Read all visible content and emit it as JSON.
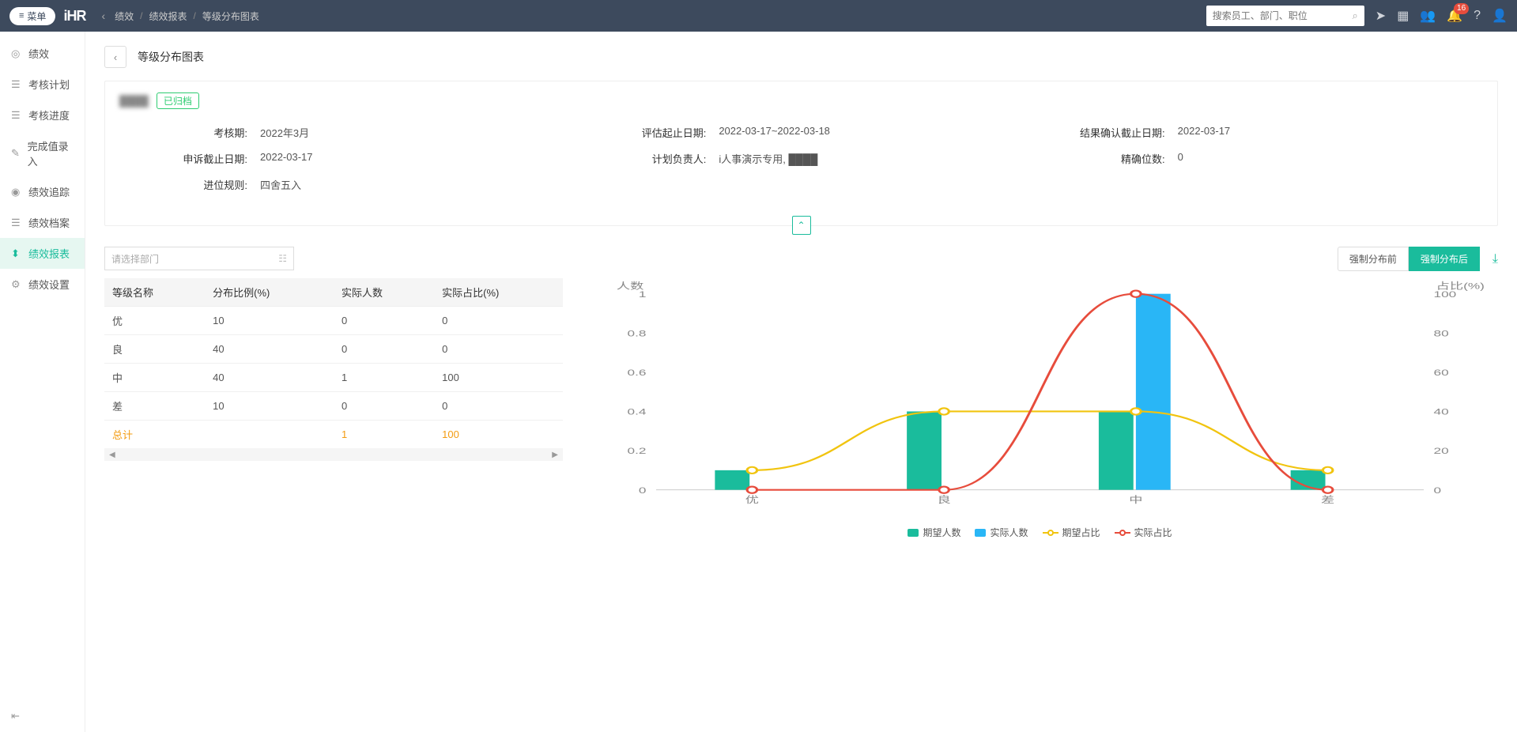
{
  "header": {
    "menu_label": "菜单",
    "logo": "iHR",
    "breadcrumb": [
      "绩效",
      "绩效报表",
      "等级分布图表"
    ],
    "search_placeholder": "搜索员工、部门、职位",
    "notification_count": "16"
  },
  "sidebar": {
    "items": [
      {
        "label": "绩效",
        "icon": "◎"
      },
      {
        "label": "考核计划",
        "icon": "☰"
      },
      {
        "label": "考核进度",
        "icon": "☰"
      },
      {
        "label": "完成值录入",
        "icon": "✎"
      },
      {
        "label": "绩效追踪",
        "icon": "◉"
      },
      {
        "label": "绩效档案",
        "icon": "☰"
      },
      {
        "label": "绩效报表",
        "icon": "⬍"
      },
      {
        "label": "绩效设置",
        "icon": "⚙"
      }
    ],
    "active_index": 6
  },
  "page": {
    "title": "等级分布图表",
    "card_title_blur": "████",
    "status": "已归档",
    "info": {
      "col1": [
        {
          "label": "考核期:",
          "value": "2022年3月"
        },
        {
          "label": "申诉截止日期:",
          "value": "2022-03-17"
        },
        {
          "label": "进位规则:",
          "value": "四舍五入"
        }
      ],
      "col2": [
        {
          "label": "评估起止日期:",
          "value": "2022-03-17~2022-03-18"
        },
        {
          "label": "计划负责人:",
          "value": "i人事演示专用, ████"
        }
      ],
      "col3": [
        {
          "label": "结果确认截止日期:",
          "value": "2022-03-17"
        },
        {
          "label": "精确位数:",
          "value": "0"
        }
      ]
    }
  },
  "filter": {
    "dept_placeholder": "请选择部门"
  },
  "table": {
    "headers": [
      "等级名称",
      "分布比例(%)",
      "实际人数",
      "实际占比(%)"
    ],
    "rows": [
      {
        "name": "优",
        "ratio": "10",
        "count": "0",
        "pct": "0"
      },
      {
        "name": "良",
        "ratio": "40",
        "count": "0",
        "pct": "0"
      },
      {
        "name": "中",
        "ratio": "40",
        "count": "1",
        "pct": "100"
      },
      {
        "name": "差",
        "ratio": "10",
        "count": "0",
        "pct": "0"
      }
    ],
    "total": {
      "name": "总计",
      "ratio": "",
      "count": "1",
      "pct": "100"
    }
  },
  "tabs": {
    "before": "强制分布前",
    "after": "强制分布后"
  },
  "chart_data": {
    "type": "bar+line",
    "y_left_label": "人数",
    "y_right_label": "占比(%)",
    "y_left_ticks": [
      0,
      0.2,
      0.4,
      0.6,
      0.8,
      1
    ],
    "y_right_ticks": [
      0,
      20,
      40,
      60,
      80,
      100
    ],
    "categories": [
      "优",
      "良",
      "中",
      "差"
    ],
    "series": [
      {
        "name": "期望人数",
        "type": "bar",
        "color": "#1abc9c",
        "values": [
          0.1,
          0.4,
          0.4,
          0.1
        ]
      },
      {
        "name": "实际人数",
        "type": "bar",
        "color": "#29b6f6",
        "values": [
          0,
          0,
          1,
          0
        ]
      },
      {
        "name": "期望占比",
        "type": "line",
        "color": "#f1c40f",
        "values": [
          10,
          40,
          40,
          10
        ]
      },
      {
        "name": "实际占比",
        "type": "line",
        "color": "#e74c3c",
        "values": [
          0,
          0,
          100,
          0
        ]
      }
    ],
    "legend": [
      "期望人数",
      "实际人数",
      "期望占比",
      "实际占比"
    ]
  }
}
